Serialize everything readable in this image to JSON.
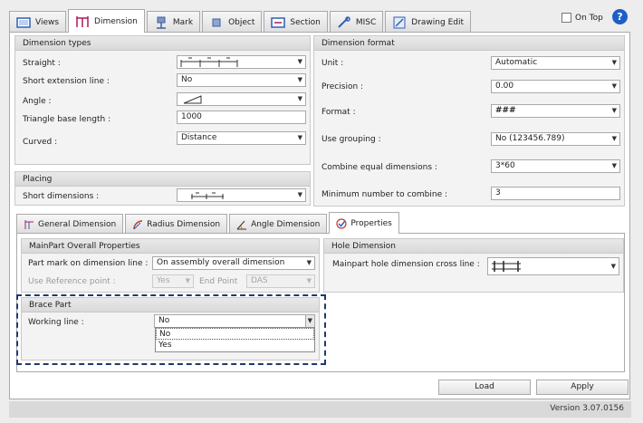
{
  "tabs": [
    {
      "label": "Views",
      "icon": "views-icon",
      "active": false
    },
    {
      "label": "Dimension",
      "icon": "dimension-icon",
      "active": true
    },
    {
      "label": "Mark",
      "icon": "mark-icon",
      "active": false
    },
    {
      "label": "Object",
      "icon": "object-icon",
      "active": false
    },
    {
      "label": "Section",
      "icon": "section-icon",
      "active": false
    },
    {
      "label": "MISC",
      "icon": "misc-icon",
      "active": false
    },
    {
      "label": "Drawing Edit",
      "icon": "drawing-edit-icon",
      "active": false
    }
  ],
  "on_top": {
    "label": "On Top",
    "checked": false
  },
  "help_label": "?",
  "dimension_types": {
    "title": "Dimension types",
    "straight_label": "Straight :",
    "short_extension_label": "Short extension line :",
    "short_extension_value": "No",
    "angle_label": "Angle  :",
    "triangle_base_label": "Triangle base length :",
    "triangle_base_value": "1000",
    "curved_label": "Curved :",
    "curved_value": "Distance"
  },
  "dimension_format": {
    "title": "Dimension format",
    "unit_label": "Unit :",
    "unit_value": "Automatic",
    "precision_label": "Precision :",
    "precision_value": "0.00",
    "format_label": "Format :",
    "format_value": "###",
    "use_grouping_label": "Use grouping :",
    "use_grouping_value": "No (123456.789)",
    "combine_equal_label": "Combine equal dimensions :",
    "combine_equal_value": "3*60",
    "min_combine_label": "Minimum number to combine :",
    "min_combine_value": "3"
  },
  "placing": {
    "title": "Placing",
    "short_dimensions_label": "Short dimensions :"
  },
  "subtabs": [
    {
      "label": "General Dimension",
      "icon": "general-dimension-icon",
      "active": false
    },
    {
      "label": "Radius Dimension",
      "icon": "radius-dimension-icon",
      "active": false
    },
    {
      "label": "Angle Dimension",
      "icon": "angle-dimension-icon",
      "active": false
    },
    {
      "label": "Properties",
      "icon": "properties-icon",
      "active": true
    }
  ],
  "mainpart": {
    "title": "MainPart Overall Properties",
    "part_mark_label": "Part mark on dimension line :",
    "part_mark_value": "On assembly overall dimension",
    "use_ref_label": "Use Reference point :",
    "use_ref_value": "Yes",
    "end_point_label": "End Point",
    "end_point_value": "DAS"
  },
  "hole": {
    "title": "Hole Dimension",
    "cross_line_label": "Mainpart hole dimension cross line :"
  },
  "brace": {
    "title": "Brace Part",
    "working_line_label": "Working line :",
    "working_line_value": "No",
    "options": [
      "No",
      "Yes"
    ]
  },
  "buttons": {
    "load": "Load",
    "apply": "Apply"
  },
  "version": "Version 3.07.0156"
}
